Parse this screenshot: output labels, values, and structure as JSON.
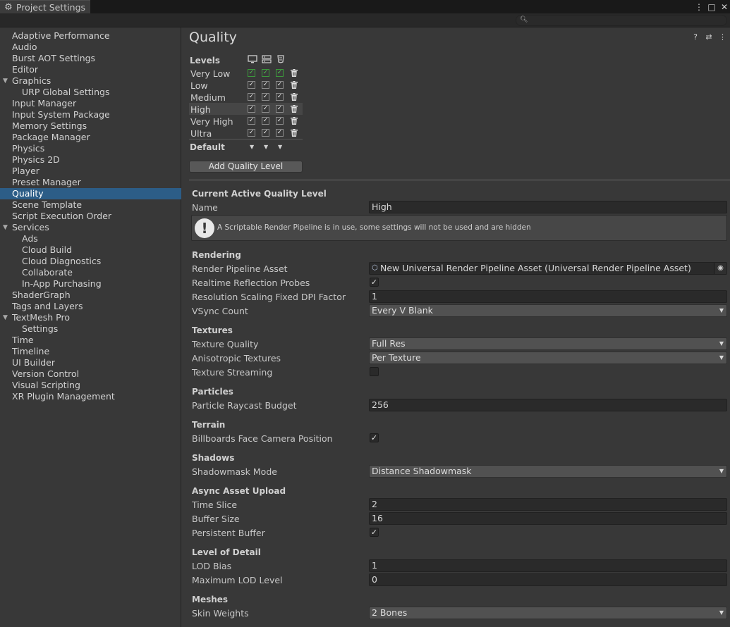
{
  "window": {
    "tab_title": "Project Settings"
  },
  "sidebar": {
    "items": [
      {
        "label": "Adaptive Performance",
        "indent": 0
      },
      {
        "label": "Audio",
        "indent": 0
      },
      {
        "label": "Burst AOT Settings",
        "indent": 0
      },
      {
        "label": "Editor",
        "indent": 0
      },
      {
        "label": "Graphics",
        "indent": 0,
        "expanded": true
      },
      {
        "label": "URP Global Settings",
        "indent": 1
      },
      {
        "label": "Input Manager",
        "indent": 0
      },
      {
        "label": "Input System Package",
        "indent": 0
      },
      {
        "label": "Memory Settings",
        "indent": 0
      },
      {
        "label": "Package Manager",
        "indent": 0
      },
      {
        "label": "Physics",
        "indent": 0
      },
      {
        "label": "Physics 2D",
        "indent": 0
      },
      {
        "label": "Player",
        "indent": 0
      },
      {
        "label": "Preset Manager",
        "indent": 0
      },
      {
        "label": "Quality",
        "indent": 0,
        "selected": true
      },
      {
        "label": "Scene Template",
        "indent": 0
      },
      {
        "label": "Script Execution Order",
        "indent": 0
      },
      {
        "label": "Services",
        "indent": 0,
        "expanded": true
      },
      {
        "label": "Ads",
        "indent": 1
      },
      {
        "label": "Cloud Build",
        "indent": 1
      },
      {
        "label": "Cloud Diagnostics",
        "indent": 1
      },
      {
        "label": "Collaborate",
        "indent": 1
      },
      {
        "label": "In-App Purchasing",
        "indent": 1
      },
      {
        "label": "ShaderGraph",
        "indent": 0
      },
      {
        "label": "Tags and Layers",
        "indent": 0
      },
      {
        "label": "TextMesh Pro",
        "indent": 0,
        "expanded": true
      },
      {
        "label": "Settings",
        "indent": 1
      },
      {
        "label": "Time",
        "indent": 0
      },
      {
        "label": "Timeline",
        "indent": 0
      },
      {
        "label": "UI Builder",
        "indent": 0
      },
      {
        "label": "Version Control",
        "indent": 0
      },
      {
        "label": "Visual Scripting",
        "indent": 0
      },
      {
        "label": "XR Plugin Management",
        "indent": 0
      }
    ]
  },
  "main": {
    "title": "Quality",
    "levels": {
      "label": "Levels",
      "rows": [
        {
          "name": "Very Low",
          "platforms": [
            true,
            true,
            true
          ],
          "default_for": [
            true,
            true,
            true
          ],
          "selected": false
        },
        {
          "name": "Low",
          "platforms": [
            true,
            true,
            true
          ],
          "default_for": [
            false,
            false,
            false
          ],
          "selected": false
        },
        {
          "name": "Medium",
          "platforms": [
            true,
            true,
            true
          ],
          "default_for": [
            false,
            false,
            false
          ],
          "selected": false
        },
        {
          "name": "High",
          "platforms": [
            true,
            true,
            true
          ],
          "default_for": [
            false,
            false,
            false
          ],
          "selected": true
        },
        {
          "name": "Very High",
          "platforms": [
            true,
            true,
            true
          ],
          "default_for": [
            false,
            false,
            false
          ],
          "selected": false
        },
        {
          "name": "Ultra",
          "platforms": [
            true,
            true,
            true
          ],
          "default_for": [
            false,
            false,
            false
          ],
          "selected": false
        }
      ],
      "default_label": "Default",
      "add_button": "Add Quality Level"
    },
    "active": {
      "header": "Current Active Quality Level",
      "name_label": "Name",
      "name_value": "High",
      "help_text": "A Scriptable Render Pipeline is in use, some settings will not be used and are hidden"
    },
    "rendering": {
      "header": "Rendering",
      "pipeline_label": "Render Pipeline Asset",
      "pipeline_value": "New Universal Render Pipeline Asset (Universal Render Pipeline Asset)",
      "reflection_label": "Realtime Reflection Probes",
      "reflection_checked": true,
      "dpi_label": "Resolution Scaling Fixed DPI Factor",
      "dpi_value": "1",
      "vsync_label": "VSync Count",
      "vsync_value": "Every V Blank"
    },
    "textures": {
      "header": "Textures",
      "quality_label": "Texture Quality",
      "quality_value": "Full Res",
      "aniso_label": "Anisotropic Textures",
      "aniso_value": "Per Texture",
      "streaming_label": "Texture Streaming",
      "streaming_checked": false
    },
    "particles": {
      "header": "Particles",
      "budget_label": "Particle Raycast Budget",
      "budget_value": "256"
    },
    "terrain": {
      "header": "Terrain",
      "billboard_label": "Billboards Face Camera Position",
      "billboard_checked": true
    },
    "shadows": {
      "header": "Shadows",
      "mode_label": "Shadowmask Mode",
      "mode_value": "Distance Shadowmask"
    },
    "async": {
      "header": "Async Asset Upload",
      "slice_label": "Time Slice",
      "slice_value": "2",
      "buffer_label": "Buffer Size",
      "buffer_value": "16",
      "persistent_label": "Persistent Buffer",
      "persistent_checked": true
    },
    "lod": {
      "header": "Level of Detail",
      "bias_label": "LOD Bias",
      "bias_value": "1",
      "max_label": "Maximum LOD Level",
      "max_value": "0"
    },
    "meshes": {
      "header": "Meshes",
      "skin_label": "Skin Weights",
      "skin_value": "2 Bones"
    }
  },
  "icons": {
    "tab_icon": "gear-icon",
    "platforms": [
      "standalone-monitor-icon",
      "server-icon",
      "webgl-html5-icon"
    ],
    "level_action": "trash-icon"
  },
  "colors": {
    "selection": "#2c5d87",
    "default_check": "#4cc24c",
    "background": "#383838",
    "field": "#2a2a2a"
  }
}
